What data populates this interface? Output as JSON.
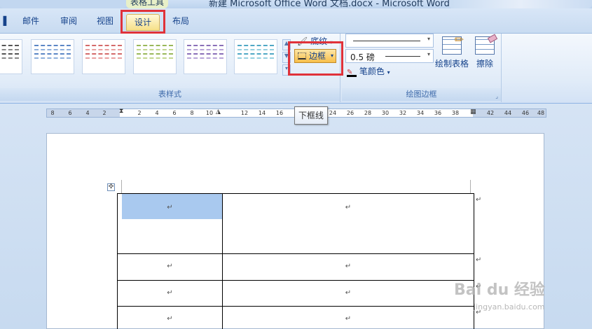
{
  "window": {
    "title": "新建 Microsoft Office Word 文档.docx - Microsoft Word",
    "context_label": "表格工具"
  },
  "tabs": [
    {
      "label": "邮件"
    },
    {
      "label": "审阅"
    },
    {
      "label": "视图"
    },
    {
      "label": "设计",
      "active": true
    },
    {
      "label": "布局"
    }
  ],
  "ribbon": {
    "table_styles_group": "表样式",
    "shading_label": "底纹",
    "borders_label": "边框",
    "draw_borders_group": "绘图边框",
    "pen_weight": "0.5 磅",
    "pen_color_label": "笔颜色",
    "draw_table_label": "绘制表格",
    "eraser_label": "擦除"
  },
  "tooltip": "下框线",
  "ruler": {
    "left_ticks": [
      "8",
      "6",
      "4",
      "2"
    ],
    "right_ticks": [
      "2",
      "4",
      "6",
      "8",
      "10",
      "12",
      "14",
      "16",
      "18",
      "20",
      "22",
      "24",
      "26",
      "28",
      "30",
      "32",
      "34",
      "36",
      "38",
      "40",
      "42",
      "44",
      "46",
      "48"
    ]
  },
  "document": {
    "cell_mark": "↵",
    "rows": 4
  },
  "watermark": {
    "brand": "Bai du 经验",
    "url": "jingyan.baidu.com"
  },
  "colors": {
    "highlight_box": "#e0323a",
    "selection": "#a9c9ef",
    "active_button": "#f8bf4a"
  }
}
